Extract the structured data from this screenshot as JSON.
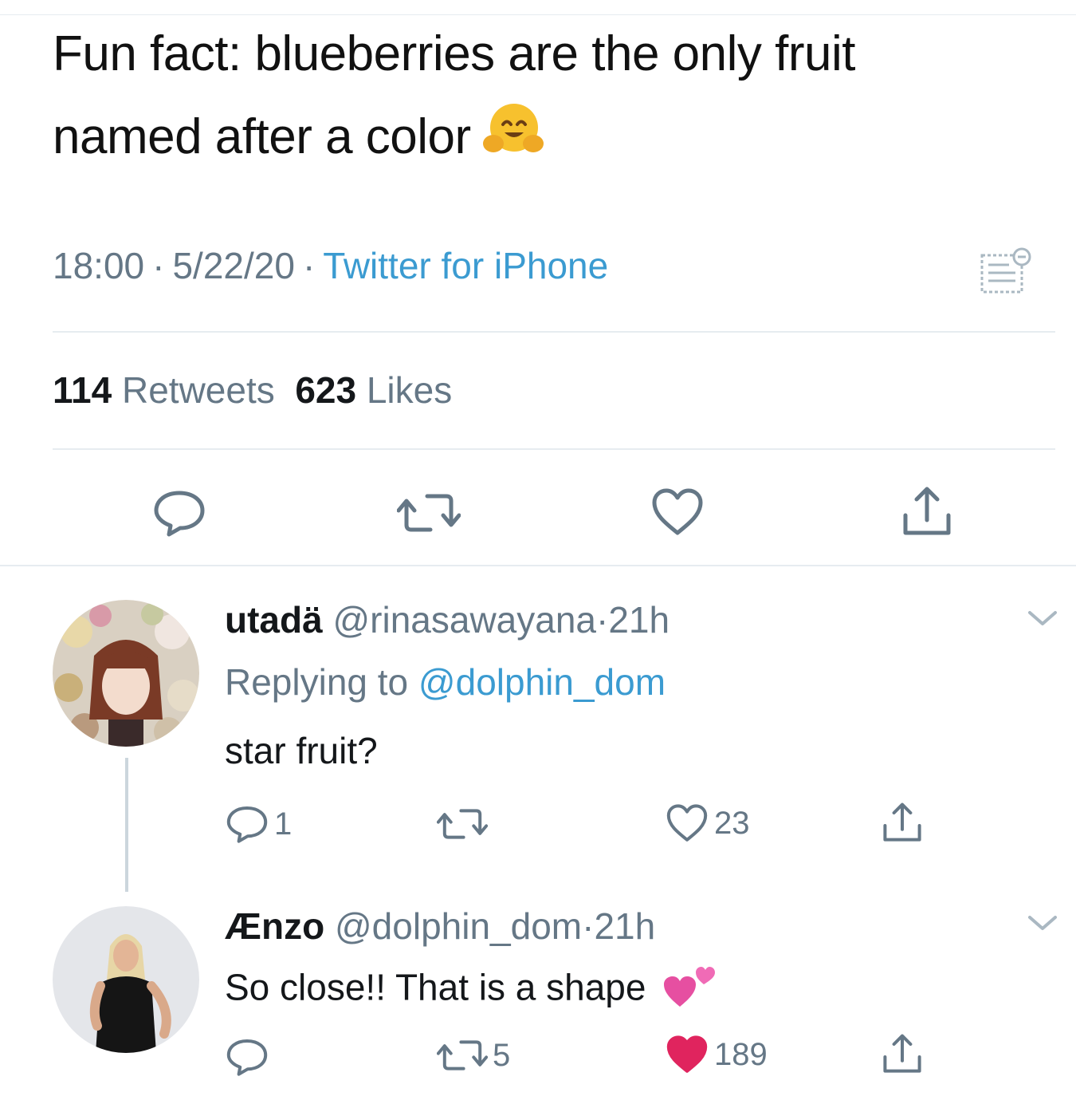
{
  "tweet": {
    "text_line1": "Fun fact: blueberries are the only fruit",
    "text_line2": "named after a color",
    "emoji": "hugging-face",
    "time": "18:00",
    "date": "5/22/20",
    "source": "Twitter for iPhone",
    "retweet_count": "114",
    "retweet_label": "Retweets",
    "like_count": "623",
    "like_label": "Likes"
  },
  "replies": [
    {
      "name": "utadä",
      "handle": "@rinasawayana",
      "time": "21h",
      "replying_prefix": "Replying to",
      "replying_handle": "@dolphin_dom",
      "text": "star fruit?",
      "reply_count": "1",
      "retweet_count": "",
      "like_count": "23",
      "liked": false
    },
    {
      "name": "Ænzo",
      "handle": "@dolphin_dom",
      "time": "21h",
      "text": "So close!! That is a shape",
      "emoji": "two-hearts",
      "reply_count": "",
      "retweet_count": "5",
      "like_count": "189",
      "liked": true
    }
  ],
  "colors": {
    "link": "#3b9bd1",
    "muted": "#657786",
    "like_red": "#e0245e",
    "divider": "#e6ecf0"
  },
  "separator": "·"
}
